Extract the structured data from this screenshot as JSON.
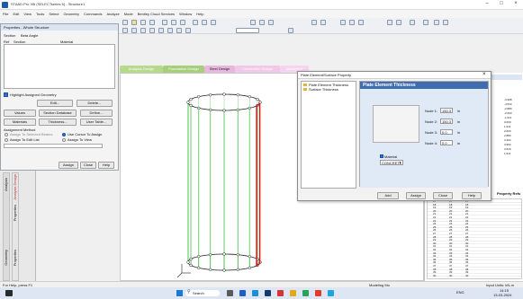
{
  "window": {
    "title": "STAAD.Pro V8i (SELECTseries 6) - Structure1",
    "controls": [
      "–",
      "□",
      "×"
    ]
  },
  "menubar": [
    "File",
    "Edit",
    "View",
    "Tools",
    "Select",
    "Geometry",
    "Commands",
    "Analyze",
    "Mode",
    "Bentley Cloud Services",
    "Window",
    "Help"
  ],
  "properties": {
    "title": "Properties - Whole Structure",
    "col_ref": "Ref",
    "col_section": "Section",
    "col_material": "Material",
    "section_label": "Section",
    "section_value": "Beta Angle",
    "highlight_label": "Highlight Assigned Geometry",
    "edit": "Edit...",
    "delete": "Delete...",
    "values": "Values",
    "section_database": "Section Database",
    "define": "Define...",
    "materials": "Materials",
    "thickness": "Thickness...",
    "user_table": "User Table...",
    "assignment_method": "Assignment Method",
    "assign_to_selected": "Assign To Selected Beams",
    "use_cursor": "Use Cursor To Assign",
    "assign_to_edit_list": "Assign To Edit List",
    "assign_to_view": "Assign To View",
    "assign": "Assign",
    "close": "Close",
    "help": "Help"
  },
  "tabs": [
    "Analysis Design",
    "Foundation Design",
    "Steel Design",
    "Connection Design",
    "Interactive"
  ],
  "left_tabs": [
    "Analysis",
    "Analysis Design",
    "Properties",
    "Geometry",
    "Properties"
  ],
  "dialog": {
    "title": "Plate Element/Surface Property",
    "close": "×",
    "tree_items": [
      "Plate Element Thickness",
      "Surface Thickness"
    ],
    "section_header": "Plate Element Thickness",
    "nodes": [
      {
        "label": "Node 1:",
        "value": "150.3",
        "unit": "in"
      },
      {
        "label": "Node 2:",
        "value": "150.3",
        "unit": "in"
      },
      {
        "label": "Node 3:",
        "value": "0.0",
        "unit": "in"
      },
      {
        "label": "Node 4:",
        "value": "0.0",
        "unit": "in"
      }
    ],
    "material_label": "Material",
    "material_value": "CONCRETE",
    "add": "Add",
    "assign": "Assign",
    "close_btn": "Close",
    "help": "Help"
  },
  "right_panel": {
    "header": "Property Refs",
    "values": [
      "-3.998",
      "-4.533",
      "-2.880",
      "-2.000",
      "-1.011",
      "0.000",
      "1.011",
      "2.000",
      "2.880",
      "3.404",
      "3.994",
      "3.620",
      "1.511"
    ]
  },
  "table_rows": [
    [
      "17",
      "17",
      "17"
    ],
    [
      "18",
      "18",
      "18"
    ],
    [
      "19",
      "19",
      "19"
    ],
    [
      "20",
      "20",
      "20"
    ],
    [
      "21",
      "21",
      "21"
    ],
    [
      "22",
      "22",
      "22"
    ],
    [
      "23",
      "23",
      "23"
    ],
    [
      "24",
      "24",
      "24"
    ],
    [
      "25",
      "25",
      "25"
    ],
    [
      "26",
      "26",
      "26"
    ],
    [
      "27",
      "27",
      "27"
    ],
    [
      "28",
      "28",
      "28"
    ],
    [
      "29",
      "29",
      "29"
    ],
    [
      "30",
      "30",
      "30"
    ],
    [
      "31",
      "31",
      "31"
    ],
    [
      "32",
      "32",
      "32"
    ],
    [
      "33",
      "33",
      "33"
    ],
    [
      "34",
      "34",
      "34"
    ],
    [
      "35",
      "35",
      "35"
    ],
    [
      "36",
      "36",
      "36"
    ],
    [
      "37",
      "37",
      "37"
    ],
    [
      "38",
      "38",
      "38"
    ],
    [
      "39",
      "39",
      "39"
    ],
    [
      "40",
      "40",
      "40"
    ]
  ],
  "status": {
    "left": "For Help, press F1",
    "mid": "Modeling Mo",
    "right": "Input Units: kN-m"
  },
  "taskbar": {
    "search": "Search",
    "lang": "ENG",
    "time": "14:15",
    "date": "13-03-2024"
  },
  "colors": {
    "accent": "#1e5aa8",
    "highlight_member": "#d4161c",
    "plate_lines": "#3cba3c"
  }
}
